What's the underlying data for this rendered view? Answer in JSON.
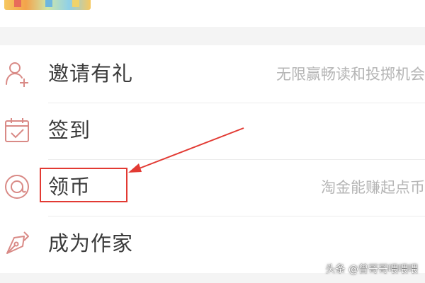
{
  "menu": {
    "items": [
      {
        "label": "邀请有礼",
        "hint": "无限赢畅读和投掷机会",
        "icon": "add-user-icon"
      },
      {
        "label": "签到",
        "hint": "",
        "icon": "calendar-check-icon"
      },
      {
        "label": "领币",
        "hint": "淘金能赚起点币",
        "icon": "coin-icon"
      },
      {
        "label": "成为作家",
        "hint": "",
        "icon": "pen-nib-icon"
      }
    ]
  },
  "annotation": {
    "color": "#e23a33",
    "target": "领币"
  },
  "watermark": {
    "text": "头条 @曾哥哥喂喂喂"
  },
  "colors": {
    "icon_accent": "#d98a86",
    "label": "#3b3b3b",
    "hint": "#b5b5b5"
  }
}
